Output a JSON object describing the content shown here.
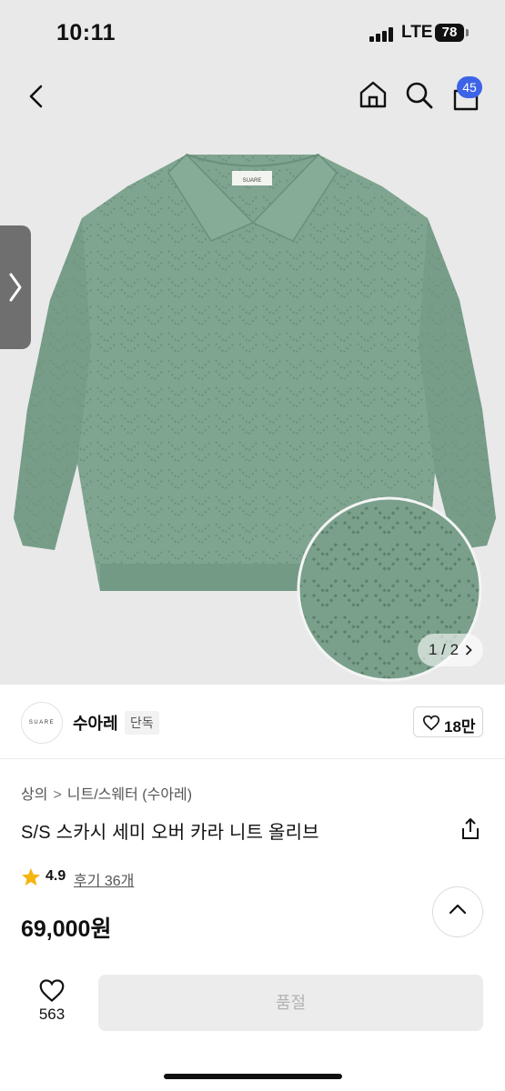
{
  "status_bar": {
    "time": "10:11",
    "network": "LTE",
    "battery": "78"
  },
  "nav": {
    "cart_count": "45"
  },
  "gallery": {
    "counter": "1 / 2",
    "brand_label_on_garment": "SUARE"
  },
  "brand": {
    "logo_text": "SUARE",
    "name": "수아레",
    "tag": "단독",
    "likes": "18만"
  },
  "breadcrumb": {
    "level1": "상의",
    "separator": ">",
    "level2": "니트/스웨터 (수아레)"
  },
  "product": {
    "title": "S/S 스카시 세미 오버 카라 니트 올리브",
    "rating": "4.9",
    "reviews": "후기 36개",
    "price": "69,000원"
  },
  "bottom": {
    "wish_count": "563",
    "buy_label": "품절"
  },
  "colors": {
    "accent": "#3d63e6",
    "sweater": "#7fa590",
    "star": "#f5b50f"
  }
}
